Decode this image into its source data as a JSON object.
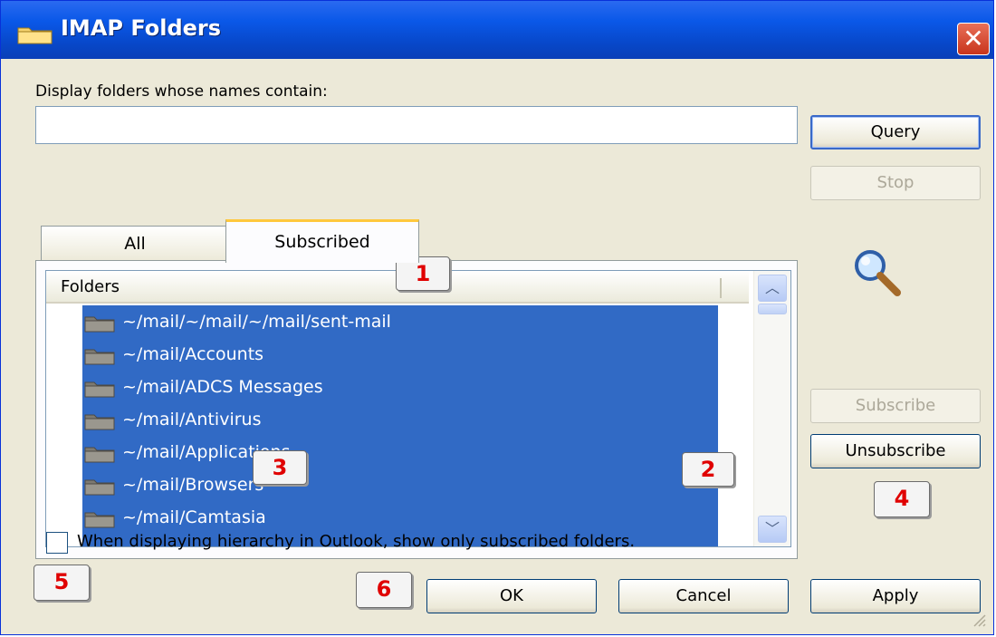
{
  "window": {
    "title": "IMAP Folders",
    "close_glyph": "✕"
  },
  "filter": {
    "label": "Display folders whose names contain:",
    "value": "",
    "placeholder": ""
  },
  "buttons": {
    "query": "Query",
    "stop": "Stop",
    "subscribe": "Subscribe",
    "unsubscribe": "Unsubscribe",
    "ok": "OK",
    "cancel": "Cancel",
    "apply": "Apply"
  },
  "tabs": [
    {
      "label": "All",
      "active": false
    },
    {
      "label": "Subscribed",
      "active": true
    }
  ],
  "list": {
    "column_header": "Folders",
    "items": [
      "~/mail/~/mail/~/mail/sent-mail",
      "~/mail/Accounts",
      "~/mail/ADCS Messages",
      "~/mail/Antivirus",
      "~/mail/Applications",
      "~/mail/Browsers",
      "~/mail/Camtasia"
    ],
    "scroll_up_glyph": "︿",
    "scroll_down_glyph": "﹀"
  },
  "option": {
    "label": "When displaying hierarchy in Outlook, show only subscribed folders.",
    "checked": false
  },
  "callouts": [
    "1",
    "2",
    "3",
    "4",
    "5",
    "6"
  ],
  "icons": [
    "folder-icon",
    "close-icon",
    "magnifier-icon",
    "chevron-up-icon",
    "chevron-down-icon",
    "resize-grip-icon"
  ],
  "colors": {
    "titlebar": "#0a58e8",
    "selection": "#316ac5",
    "callout_text": "#e00000",
    "tab_highlight": "#ffc83c",
    "dialog_bg": "#ece9d8"
  }
}
